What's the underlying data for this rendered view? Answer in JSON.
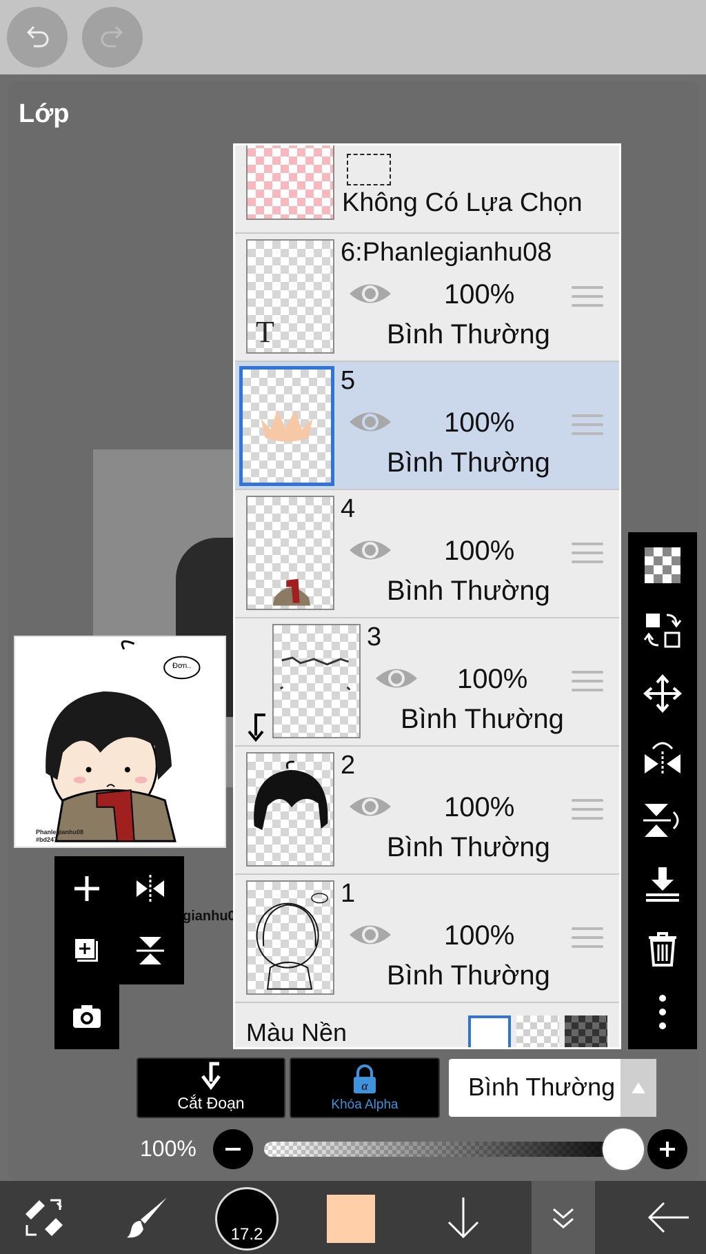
{
  "app": {
    "panel_title": "Lớp",
    "background_canvas_text": "gianhu0"
  },
  "preview": {
    "signature_line1": "Phanlegianhu08",
    "signature_line2": "#bd247",
    "speech_text": "Đơn.."
  },
  "selection_row": {
    "label": "Không Có Lựa Chọn"
  },
  "layers": [
    {
      "name": "6:Phanlegianhu08",
      "opacity": "100%",
      "mode": "Bình Thường",
      "visible": true,
      "selected": false,
      "thumb_letter": "T"
    },
    {
      "name": "5",
      "opacity": "100%",
      "mode": "Bình Thường",
      "visible": true,
      "selected": true
    },
    {
      "name": "4",
      "opacity": "100%",
      "mode": "Bình Thường",
      "visible": true,
      "selected": false
    },
    {
      "name": "3",
      "opacity": "100%",
      "mode": "Bình Thường",
      "visible": true,
      "selected": false,
      "clipped": true
    },
    {
      "name": "2",
      "opacity": "100%",
      "mode": "Bình Thường",
      "visible": true,
      "selected": false
    },
    {
      "name": "1",
      "opacity": "100%",
      "mode": "Bình Thường",
      "visible": true,
      "selected": false
    }
  ],
  "background_row": {
    "label": "Màu Nền"
  },
  "options": {
    "clipping_label": "Cắt Đoạn",
    "alpha_lock_label": "Khóa Alpha",
    "blend_mode": "Bình Thường",
    "opacity_label": "100%",
    "opacity_value": 1.0
  },
  "bottom": {
    "brush_size": "17.2",
    "current_color": "#ffcfaa"
  },
  "colors": {
    "selected_layer": "#cbd8ec",
    "selection_border": "#2f74d8",
    "alpha_lock_accent": "#3e93dc"
  }
}
